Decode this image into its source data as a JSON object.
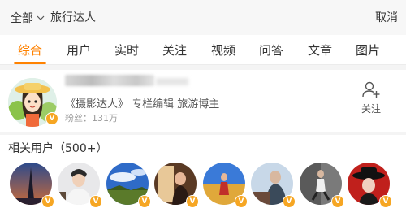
{
  "search": {
    "scope_label": "全部",
    "query": "旅行达人",
    "cancel_label": "取消"
  },
  "tabs": [
    {
      "label": "综合",
      "active": true
    },
    {
      "label": "用户"
    },
    {
      "label": "实时"
    },
    {
      "label": "关注"
    },
    {
      "label": "视频"
    },
    {
      "label": "问答"
    },
    {
      "label": "文章"
    },
    {
      "label": "图片"
    }
  ],
  "user": {
    "description": "《摄影达人》  专栏编辑 旅游博主",
    "fans": "粉丝：131万",
    "follow_label": "关注",
    "verified_mark": "V"
  },
  "related": {
    "title": "相关用户（500+）",
    "verified_mark": "V"
  },
  "colors": {
    "accent": "#ff8200",
    "badge": "#f6a623"
  }
}
